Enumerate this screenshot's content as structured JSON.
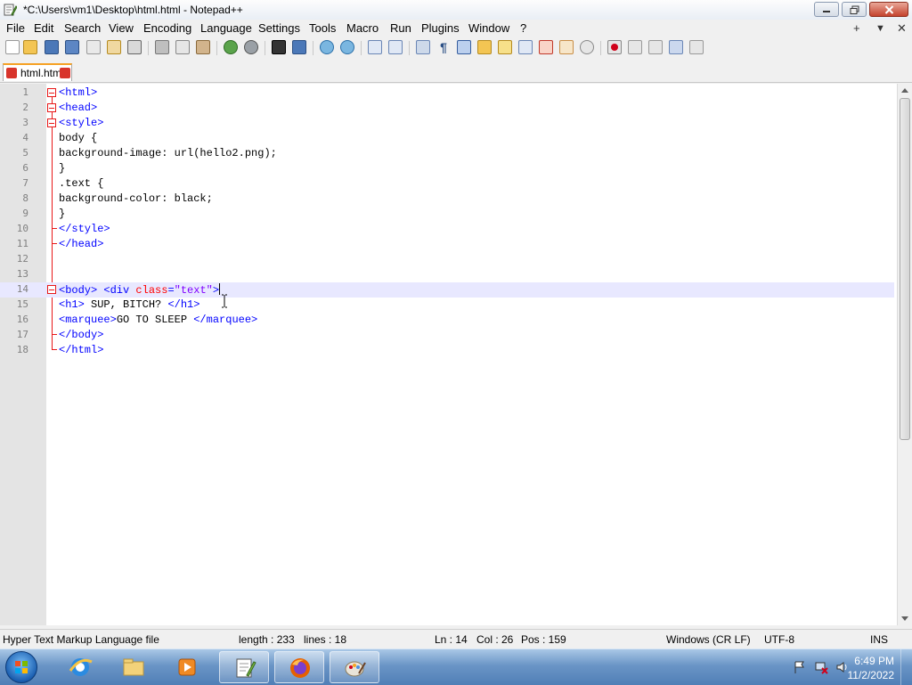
{
  "window": {
    "title": "*C:\\Users\\vm1\\Desktop\\html.html - Notepad++"
  },
  "menu": {
    "items": [
      "File",
      "Edit",
      "Search",
      "View",
      "Encoding",
      "Language",
      "Settings",
      "Tools",
      "Macro",
      "Run",
      "Plugins",
      "Window",
      "?"
    ],
    "right": [
      "+",
      "▼",
      "✕"
    ]
  },
  "tab": {
    "label": "html.html"
  },
  "editor": {
    "lines": [
      {
        "n": "1"
      },
      {
        "n": "2"
      },
      {
        "n": "3"
      },
      {
        "n": "4"
      },
      {
        "n": "5"
      },
      {
        "n": "6"
      },
      {
        "n": "7"
      },
      {
        "n": "8"
      },
      {
        "n": "9"
      },
      {
        "n": "10"
      },
      {
        "n": "11"
      },
      {
        "n": "12"
      },
      {
        "n": "13"
      },
      {
        "n": "14"
      },
      {
        "n": "15"
      },
      {
        "n": "16"
      },
      {
        "n": "17"
      },
      {
        "n": "18"
      }
    ],
    "code": {
      "l1": "<html>",
      "l2": "<head>",
      "l3": "<style>",
      "l4": "body {",
      "l5": "background-image: url(hello2.png);",
      "l6": "}",
      "l7": ".text {",
      "l8": "background-color: black;",
      "l9": "}",
      "l10": "</style>",
      "l11": "</head>",
      "l14a": "<body> <div ",
      "l14b": "class",
      "l14c": "=",
      "l14d": "\"text\"",
      "l14e": ">",
      "l15a": "<h1>",
      "l15b": " SUP, BITCH? ",
      "l15c": "</h1>",
      "l16a": "<marquee>",
      "l16b": "GO TO SLEEP ",
      "l16c": "</marquee>",
      "l17": "</body>",
      "l18": "</html>"
    }
  },
  "status": {
    "filetype": "Hyper Text Markup Language file",
    "length": "length : 233",
    "lines": "lines : 18",
    "ln": "Ln : 14",
    "col": "Col : 26",
    "pos": "Pos : 159",
    "eol": "Windows (CR LF)",
    "encoding": "UTF-8",
    "mode": "INS"
  },
  "taskbar": {
    "time": "6:49 PM",
    "date": "11/2/2022"
  },
  "colors": {
    "tag": "#0000ff",
    "attribute": "#ff0000",
    "string": "#8000ff",
    "current_line": "#e8e8ff",
    "tab_accent": "#f6a123"
  }
}
